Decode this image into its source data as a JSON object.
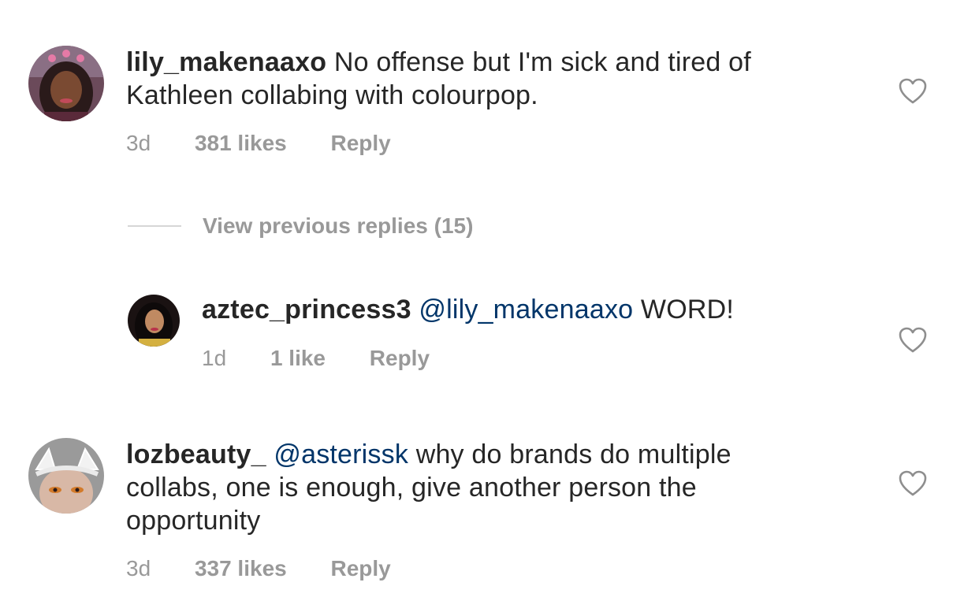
{
  "comments": [
    {
      "username": "lily_makenaaxo",
      "text_line1": "No offense but I'm sick and tired of",
      "text_line2": "Kathleen collabing with colourpop.",
      "time": "3d",
      "likes": "381 likes",
      "reply": "Reply",
      "icon": "heart-outline-icon"
    },
    {
      "username": "aztec_princess3",
      "mention": "@lily_makenaaxo",
      "text": "WORD!",
      "time": "1d",
      "likes": "1 like",
      "reply": "Reply",
      "icon": "heart-outline-icon"
    },
    {
      "username": "lozbeauty_",
      "mention": "@asterissk",
      "text_line1": "why do brands do multiple",
      "text_line2": "collabs, one is enough, give another person the",
      "text_line3": "opportunity",
      "time": "3d",
      "likes": "337 likes",
      "reply": "Reply",
      "icon": "heart-outline-icon"
    }
  ],
  "thread": {
    "view_previous": "View previous replies (15)"
  },
  "colors": {
    "text": "#262626",
    "muted": "#999999",
    "mention": "#003569",
    "divider": "#d6d6d6"
  }
}
